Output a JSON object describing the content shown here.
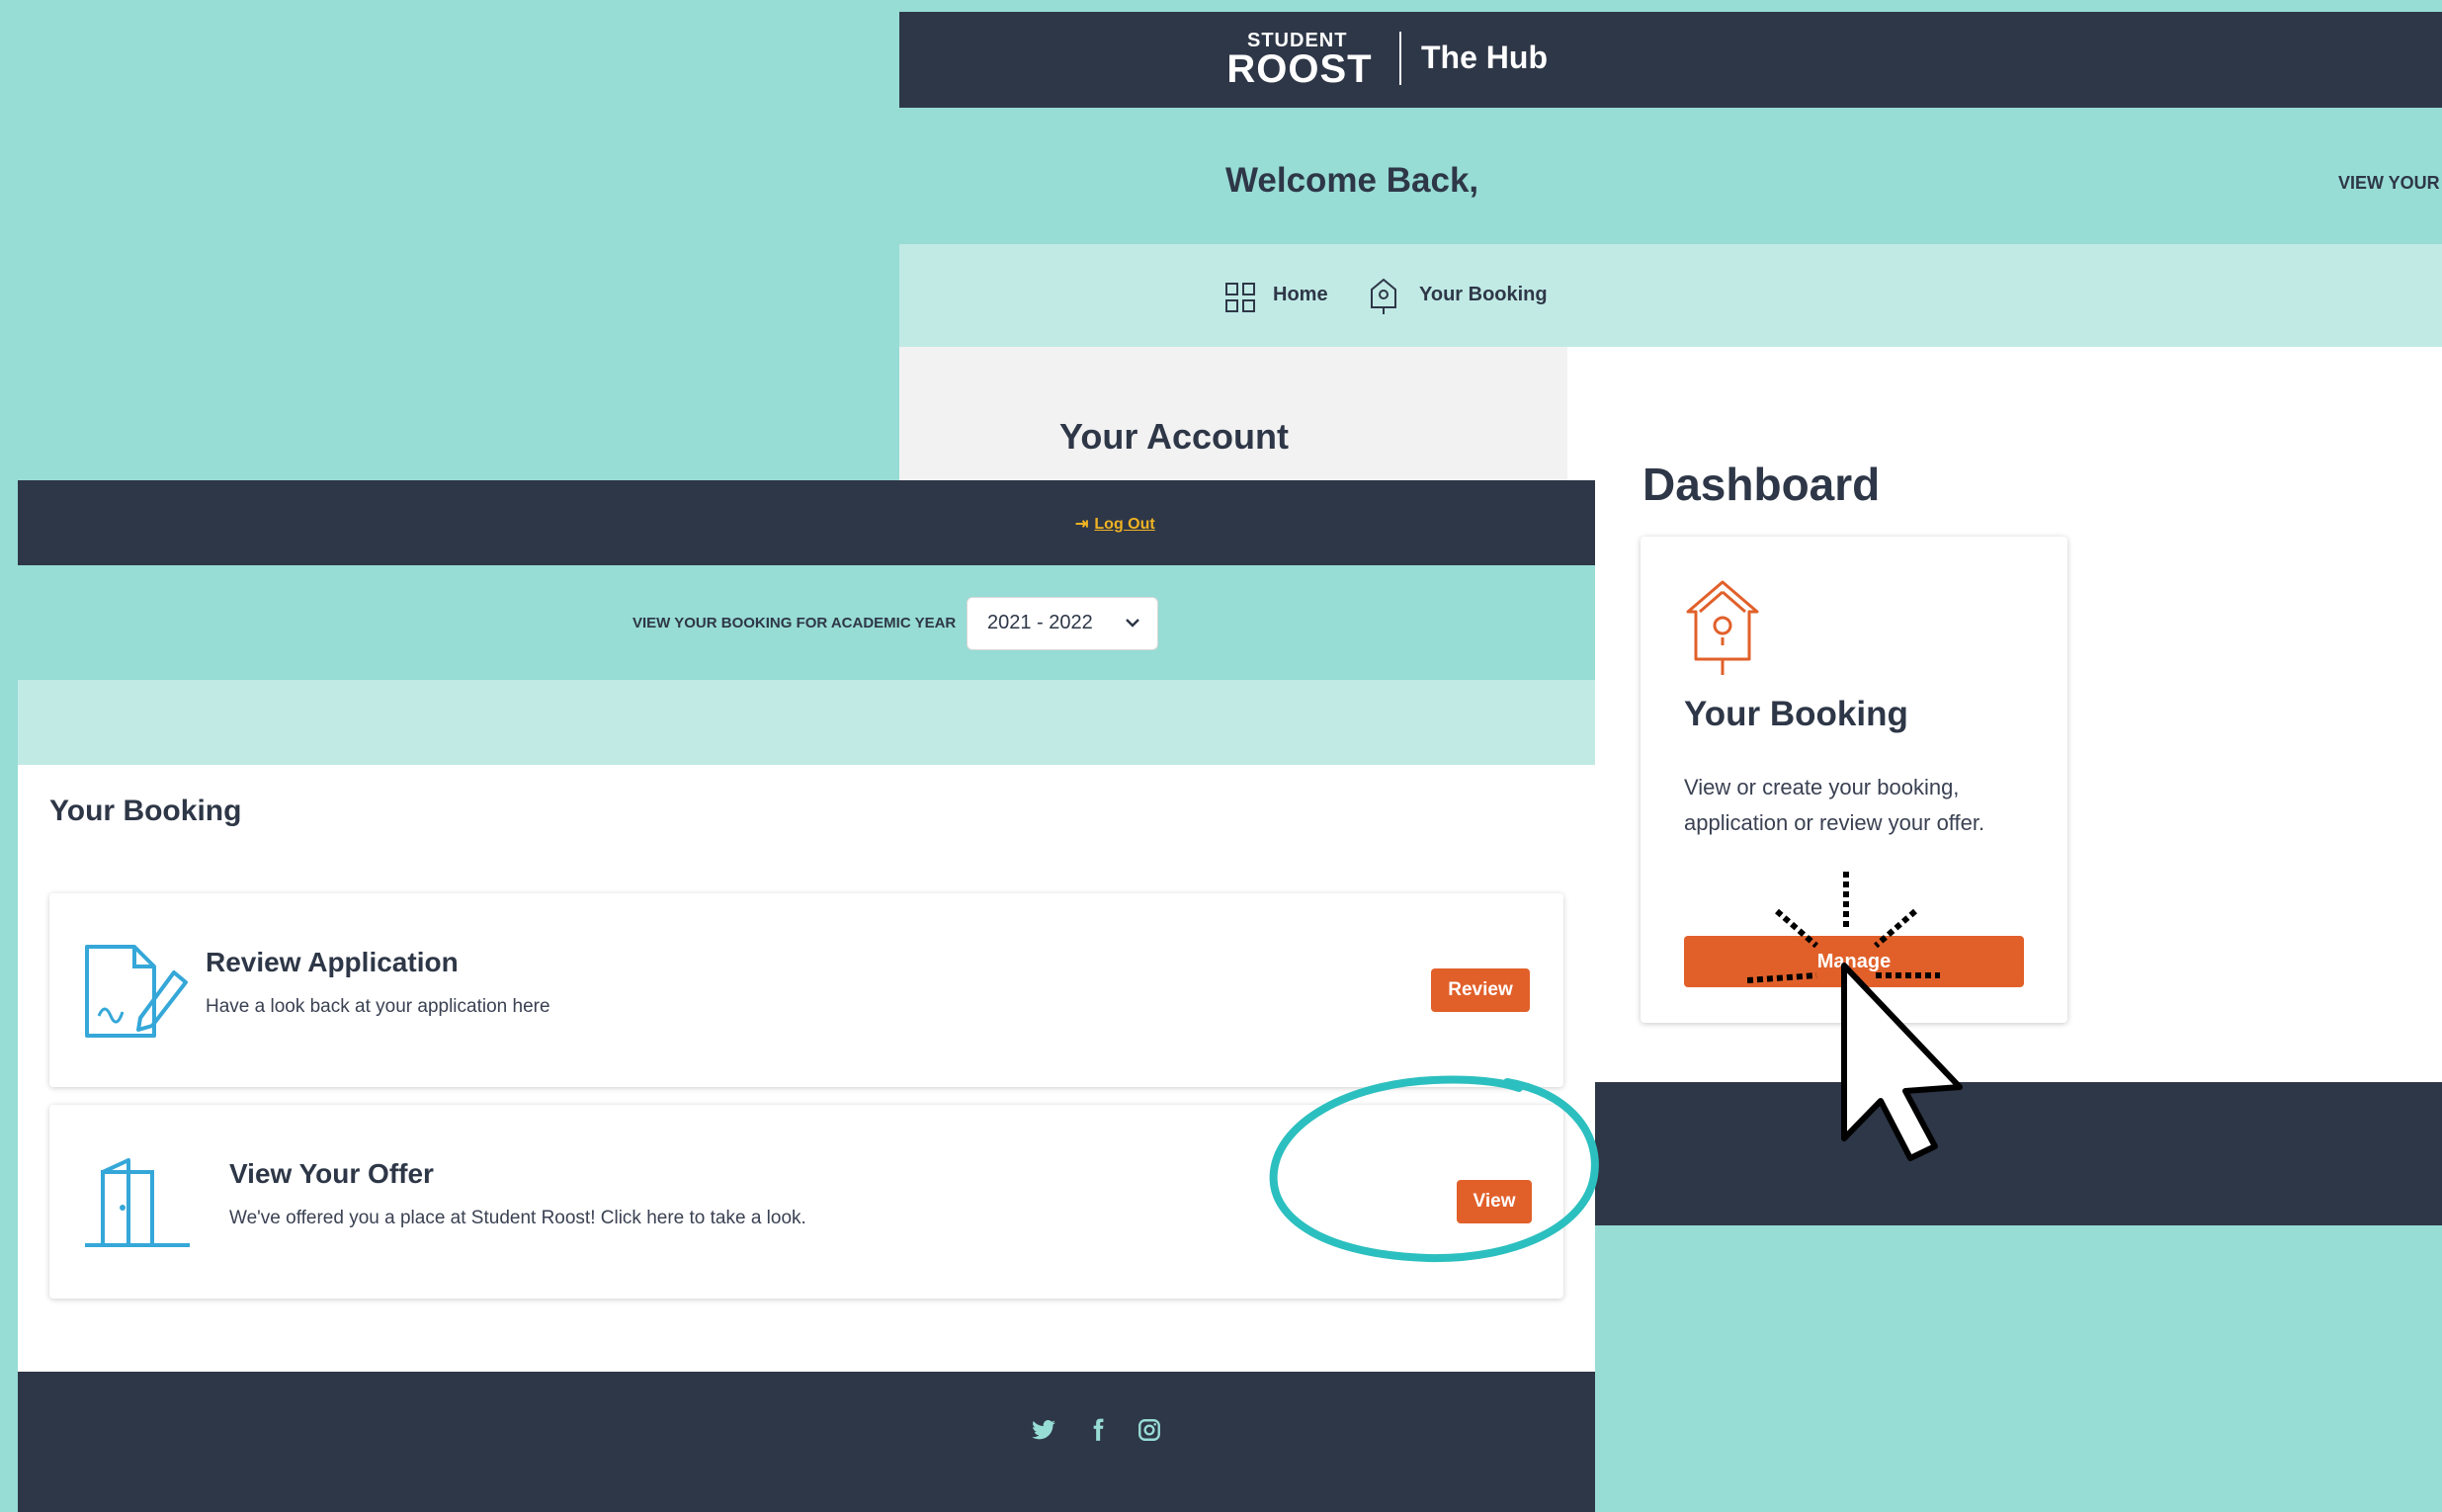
{
  "back": {
    "logo": {
      "student": "STUDENT",
      "roost": "ROOST",
      "hub": "The Hub"
    },
    "welcome": "Welcome Back,",
    "welcome_right": "VIEW YOUR",
    "nav": {
      "home": "Home",
      "your_booking": "Your Booking"
    },
    "your_account": "Your Account",
    "dashboard_title": "Dashboard",
    "card": {
      "title": "Your Booking",
      "description": "View or create your booking, application or review your offer.",
      "button": "Manage"
    }
  },
  "front": {
    "logout": "Log Out",
    "year_label": "VIEW YOUR BOOKING FOR ACADEMIC YEAR",
    "year_value": "2021 - 2022",
    "section_title": "Your Booking",
    "review_card": {
      "title": "Review Application",
      "description": "Have a look back at your application here",
      "button": "Review"
    },
    "offer_card": {
      "title": "View Your Offer",
      "description": "We've offered you a place at Student Roost! Click here to take a look.",
      "button": "View"
    },
    "footer_icons": [
      "twitter-icon",
      "facebook-icon",
      "instagram-icon"
    ]
  },
  "colors": {
    "teal": "#97dcd5",
    "light_teal": "#c1eae5",
    "navy": "#2e3747",
    "orange": "#e1602a",
    "gold": "#f0b323",
    "ring": "#2cbfbf"
  }
}
